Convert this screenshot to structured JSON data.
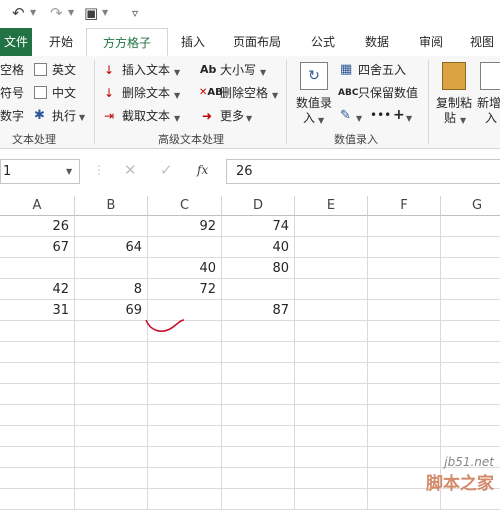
{
  "qat": {
    "undo_icon": "undo-icon",
    "redo_icon": "redo-icon",
    "customize_icon": "customize-icon"
  },
  "tabs": [
    {
      "label": "文件"
    },
    {
      "label": "开始"
    },
    {
      "label": "方方格子"
    },
    {
      "label": "插入"
    },
    {
      "label": "页面布局"
    },
    {
      "label": "公式"
    },
    {
      "label": "数据"
    },
    {
      "label": "审阅"
    },
    {
      "label": "视图"
    }
  ],
  "ribbon": {
    "text_group": {
      "items": [
        "空格",
        "英文",
        "符号",
        "中文",
        "数字",
        "执行"
      ],
      "label": "文本处理"
    },
    "advanced_group": {
      "items": [
        "插入文本",
        "删除文本",
        "截取文本",
        "大小写",
        "删除空格",
        "更多"
      ],
      "label": "高级文本处理"
    },
    "number_group": {
      "items": [
        "数值录",
        "入",
        "四舍五入",
        "只保留数值"
      ],
      "label": "数值录入"
    },
    "last_group": {
      "items": [
        "复制粘",
        "贴",
        "新增",
        "入"
      ]
    }
  },
  "formula_bar": {
    "name_box": "1",
    "formula_value": "26",
    "fx_label": "fx"
  },
  "columns": [
    "A",
    "B",
    "C",
    "D",
    "E",
    "F",
    "G"
  ],
  "rows": [
    [
      "26",
      "",
      "92",
      "74"
    ],
    [
      "67",
      "64",
      "",
      "40"
    ],
    [
      "",
      "",
      "40",
      "80"
    ],
    [
      "42",
      "8",
      "72",
      ""
    ],
    [
      "31",
      "69",
      "",
      "87"
    ],
    [
      "",
      "",
      "",
      ""
    ],
    [
      "",
      "",
      "",
      ""
    ],
    [
      "",
      "",
      "",
      ""
    ],
    [
      "",
      "",
      "",
      ""
    ],
    [
      "",
      "",
      "",
      ""
    ],
    [
      "",
      "",
      "",
      ""
    ],
    [
      "",
      "",
      "",
      ""
    ],
    [
      "",
      "",
      "",
      ""
    ],
    [
      "",
      "",
      "",
      ""
    ]
  ],
  "watermark": {
    "site": "jb51.net",
    "brand": "脚本之家"
  }
}
